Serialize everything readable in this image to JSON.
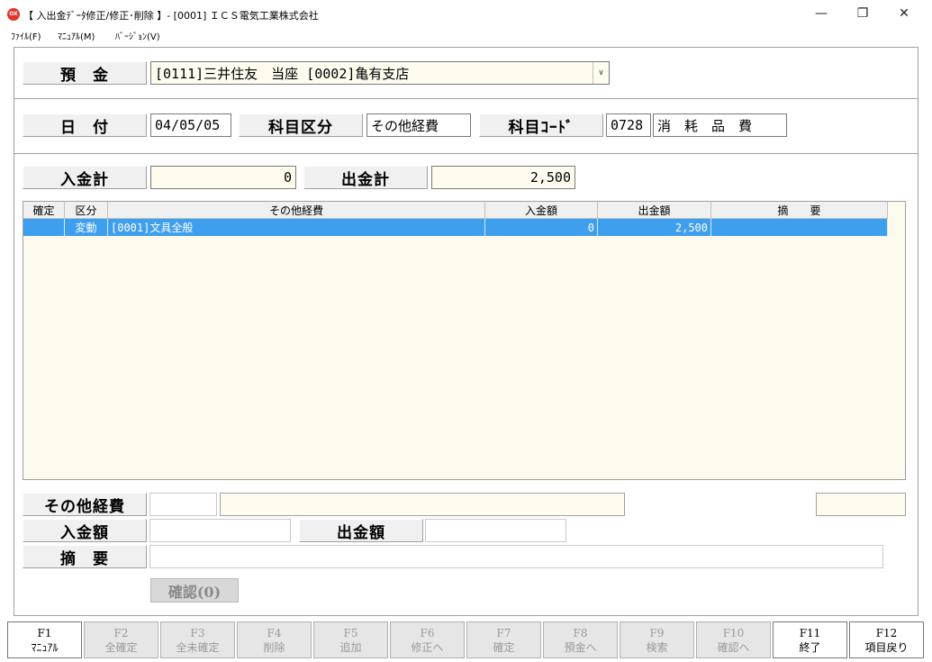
{
  "window": {
    "icon_text": "OX",
    "title": "【 入出金ﾃﾞｰﾀ修正/修正･削除 】- [0001] ＩＣＳ電気工業株式会社",
    "minimize": "—",
    "maximize": "❐",
    "close": "✕"
  },
  "menu": {
    "file": "ﾌｧｲﾙ(F)",
    "manual": "ﾏﾆｭｱﾙ(M)",
    "version": "ﾊﾞｰｼﾞｮﾝ(V)"
  },
  "deposit": {
    "label": "預　金",
    "selected": "[0111]三井住友　当座 [0002]亀有支店",
    "arrow": "∨"
  },
  "date_section": {
    "date_label": "日　付",
    "date_value": "04/05/05",
    "category_label": "科目区分",
    "category_value": "その他経費",
    "code_label": "科目ｺｰﾄﾞ",
    "code_value": "0728",
    "code_name": "消　耗　品　費"
  },
  "totals": {
    "in_label": "入金計",
    "in_value": "0",
    "out_label": "出金計",
    "out_value": "2,500"
  },
  "grid": {
    "headers": [
      "確定",
      "区分",
      "その他経費",
      "入金額",
      "出金額",
      "摘　　要"
    ],
    "rows": [
      {
        "confirmed": "",
        "kubun": "変動",
        "expense": "[0001]文具全般",
        "in": "0",
        "out": "2,500",
        "memo": ""
      }
    ]
  },
  "entry": {
    "expense_label": "その他経費",
    "in_label": "入金額",
    "out_label": "出金額",
    "memo_label": "摘　要",
    "confirm_button": "確認(0)"
  },
  "fkeys": [
    {
      "key": "F1",
      "name": "ﾏﾆｭｱﾙ",
      "active": true
    },
    {
      "key": "F2",
      "name": "全確定",
      "active": false
    },
    {
      "key": "F3",
      "name": "全未確定",
      "active": false
    },
    {
      "key": "F4",
      "name": "削除",
      "active": false
    },
    {
      "key": "F5",
      "name": "追加",
      "active": false
    },
    {
      "key": "F6",
      "name": "修正へ",
      "active": false
    },
    {
      "key": "F7",
      "name": "確定",
      "active": false
    },
    {
      "key": "F8",
      "name": "預金へ",
      "active": false
    },
    {
      "key": "F9",
      "name": "検索",
      "active": false
    },
    {
      "key": "F10",
      "name": "確認へ",
      "active": false
    },
    {
      "key": "F11",
      "name": "終了",
      "active": true
    },
    {
      "key": "F12",
      "name": "項目戻り",
      "active": true
    }
  ],
  "colors": {
    "selection": "#3f9fef",
    "cream": "#fffbef",
    "label_bg": "#f0f0f0"
  }
}
